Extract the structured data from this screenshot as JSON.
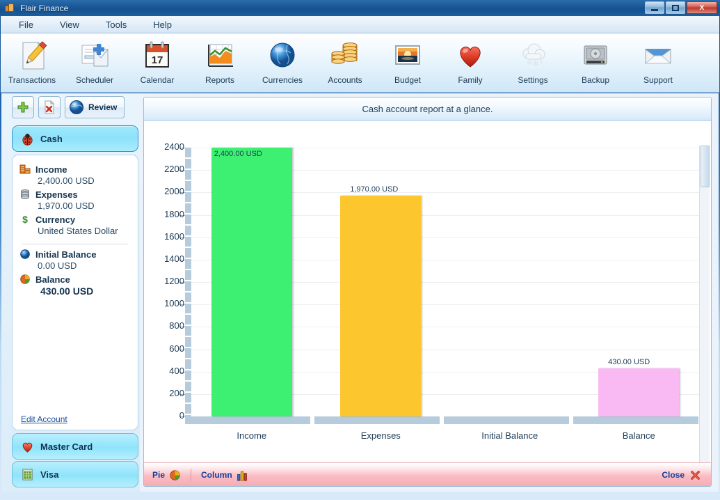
{
  "window": {
    "title": "Flair Finance",
    "icon": "application-icon",
    "controls": {
      "minimize": "minimize-button",
      "maximize": "maximize-button",
      "close": "X"
    }
  },
  "menubar": {
    "items": [
      "File",
      "View",
      "Tools",
      "Help"
    ]
  },
  "toolbar": {
    "items": [
      {
        "label": "Transactions",
        "icon": "pencil-document-icon"
      },
      {
        "label": "Scheduler",
        "icon": "document-clock-icon"
      },
      {
        "label": "Calendar",
        "icon": "calendar-17-icon"
      },
      {
        "label": "Reports",
        "icon": "bar-chart-icon"
      },
      {
        "label": "Currencies",
        "icon": "globe-icon"
      },
      {
        "label": "Accounts",
        "icon": "coins-stack-icon"
      },
      {
        "label": "Budget",
        "icon": "sunset-picture-icon"
      },
      {
        "label": "Family",
        "icon": "heart-icon"
      },
      {
        "label": "Settings",
        "icon": "cloud-snow-icon"
      },
      {
        "label": "Backup",
        "icon": "hard-drive-icon"
      },
      {
        "label": "Support",
        "icon": "envelope-icon"
      }
    ]
  },
  "sidebar": {
    "tools": {
      "add_label": "+",
      "add_icon": "green-plus-icon",
      "delete_icon": "delete-document-icon",
      "review_label": "Review",
      "review_icon": "blue-globe-icon"
    },
    "accounts": [
      {
        "label": "Cash",
        "icon": "ladybug-icon",
        "selected": true
      },
      {
        "label": "Master Card",
        "icon": "heart-icon",
        "selected": false
      },
      {
        "label": "Visa",
        "icon": "green-grid-icon",
        "selected": false
      }
    ],
    "details": [
      {
        "label": "Income",
        "icon": "income-icon",
        "value": "2,400.00 USD"
      },
      {
        "label": "Expenses",
        "icon": "database-icon",
        "value": "1,970.00 USD"
      },
      {
        "label": "Currency",
        "icon": "dollar-sign-icon",
        "value": "United States Dollar"
      },
      {
        "label": "Initial Balance",
        "icon": "blue-sphere-icon",
        "value": "0.00 USD"
      },
      {
        "label": "Balance",
        "icon": "pie-chart-icon",
        "value": "430.00 USD"
      }
    ],
    "edit_account_link": "Edit Account"
  },
  "panel": {
    "header_title": "Cash account report at a glance.",
    "footer": {
      "pie_label": "Pie",
      "pie_icon": "pie-chart-icon",
      "column_label": "Column",
      "column_icon": "column-chart-icon",
      "close_label": "Close",
      "close_icon": "red-x-icon"
    }
  },
  "chart_data": {
    "type": "bar",
    "title": "Cash account report at a glance.",
    "xlabel": "",
    "ylabel": "",
    "categories": [
      "Income",
      "Expenses",
      "Initial Balance",
      "Balance"
    ],
    "values": [
      2400,
      1970,
      0,
      430
    ],
    "data_labels": [
      "2,400.00 USD",
      "1,970.00 USD",
      "",
      "430.00 USD"
    ],
    "colors": [
      "#3ef071",
      "#fcc62f",
      "#ffffff",
      "#f9b9f2"
    ],
    "ylim": [
      0,
      2400
    ],
    "yticks": [
      0,
      200,
      400,
      600,
      800,
      1000,
      1200,
      1400,
      1600,
      1800,
      2000,
      2200,
      2400
    ],
    "grid": true,
    "legend": false,
    "currency": "USD"
  }
}
